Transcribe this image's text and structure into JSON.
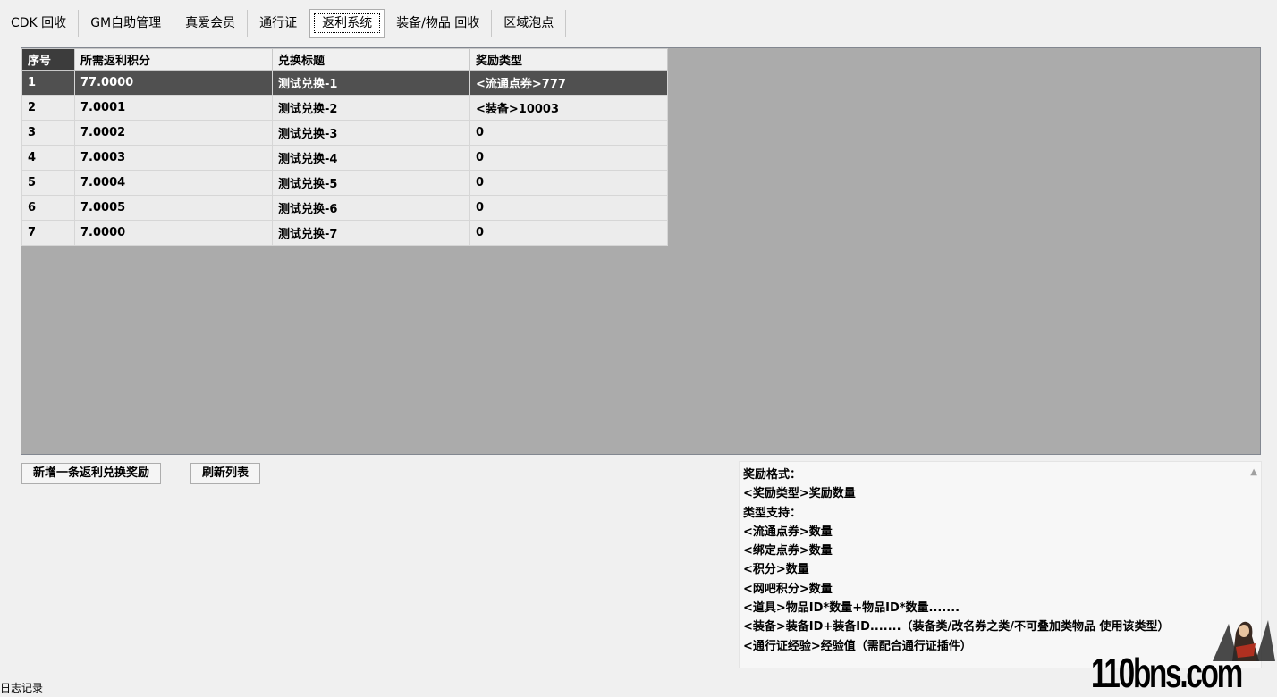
{
  "tabs": [
    {
      "label": "CDK 回收",
      "active": false
    },
    {
      "label": "GM自助管理",
      "active": false
    },
    {
      "label": "真爱会员",
      "active": false
    },
    {
      "label": "通行证",
      "active": false
    },
    {
      "label": "返利系统",
      "active": true
    },
    {
      "label": "装备/物品 回收",
      "active": false
    },
    {
      "label": "区域泡点",
      "active": false
    }
  ],
  "grid": {
    "headers": [
      "序号",
      "所需返利积分",
      "兑换标题",
      "奖励类型"
    ],
    "rows": [
      {
        "no": "1",
        "points": "77.0000",
        "title": "测试兑换-1",
        "reward": "<流通点券>777",
        "selected": true
      },
      {
        "no": "2",
        "points": "7.0001",
        "title": "测试兑换-2",
        "reward": "<装备>10003",
        "selected": false
      },
      {
        "no": "3",
        "points": "7.0002",
        "title": "测试兑换-3",
        "reward": "0",
        "selected": false
      },
      {
        "no": "4",
        "points": "7.0003",
        "title": "测试兑换-4",
        "reward": "0",
        "selected": false
      },
      {
        "no": "5",
        "points": "7.0004",
        "title": "测试兑换-5",
        "reward": "0",
        "selected": false
      },
      {
        "no": "6",
        "points": "7.0005",
        "title": "测试兑换-6",
        "reward": "0",
        "selected": false
      },
      {
        "no": "7",
        "points": "7.0000",
        "title": "测试兑换-7",
        "reward": "0",
        "selected": false
      }
    ]
  },
  "buttons": {
    "add": "新增一条返利兑换奖励",
    "refresh": "刷新列表"
  },
  "info": {
    "lines": [
      "奖励格式：",
      "<奖励类型>奖励数量",
      "类型支持：",
      "<流通点券>数量",
      "<绑定点券>数量",
      "<积分>数量",
      "<网吧积分>数量",
      "<道具>物品ID*数量+物品ID*数量.......",
      "<装备>装备ID+装备ID.......（装备类/改名券之类/不可叠加类物品 使用该类型）",
      "<通行证经验>经验值（需配合通行证插件）"
    ]
  },
  "watermark": "110bns.com",
  "log_label": "日志记录",
  "colors": {
    "grid_bg": "#ababab",
    "selected_row": "#505050",
    "header_index": "#3c3c3c"
  }
}
